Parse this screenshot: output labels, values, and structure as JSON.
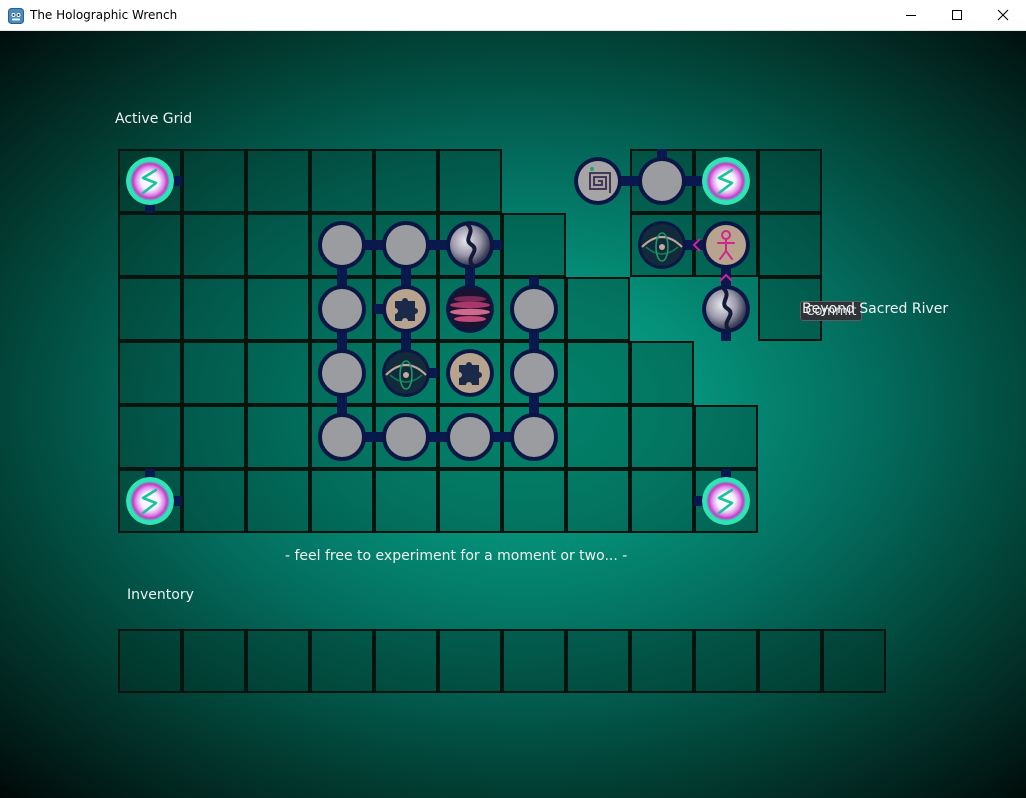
{
  "window": {
    "title": "The Holographic Wrench",
    "controls": [
      "minimize-icon",
      "maximize-icon",
      "close-icon"
    ]
  },
  "labels": {
    "active_grid": "Active Grid",
    "commit_button": "Commit",
    "result_text": "Beyond Sacred River",
    "hint": "- feel free to experiment for a moment or two... -",
    "inventory": "Inventory"
  },
  "grid": {
    "rows": [
      "######..###",
      "#######.###",
      "########..#",
      "#########..",
      "##########.",
      "##########."
    ],
    "pieces": [
      {
        "row": 0,
        "col": 0,
        "type": "spark-icon"
      },
      {
        "row": 0,
        "col": 7,
        "type": "spiral-icon"
      },
      {
        "row": 0,
        "col": 8,
        "type": "node"
      },
      {
        "row": 0,
        "col": 9,
        "type": "spark-icon"
      },
      {
        "row": 1,
        "col": 3,
        "type": "node"
      },
      {
        "row": 1,
        "col": 4,
        "type": "node"
      },
      {
        "row": 1,
        "col": 5,
        "type": "river-icon"
      },
      {
        "row": 1,
        "col": 8,
        "type": "eye-icon"
      },
      {
        "row": 1,
        "col": 9,
        "type": "figure-icon"
      },
      {
        "row": 2,
        "col": 3,
        "type": "node"
      },
      {
        "row": 2,
        "col": 4,
        "type": "puzzle-icon"
      },
      {
        "row": 2,
        "col": 5,
        "type": "disc-icon"
      },
      {
        "row": 2,
        "col": 6,
        "type": "node"
      },
      {
        "row": 2,
        "col": 9,
        "type": "river-icon"
      },
      {
        "row": 3,
        "col": 3,
        "type": "node"
      },
      {
        "row": 3,
        "col": 4,
        "type": "eye-icon"
      },
      {
        "row": 3,
        "col": 5,
        "type": "puzzle-icon"
      },
      {
        "row": 3,
        "col": 6,
        "type": "node"
      },
      {
        "row": 4,
        "col": 3,
        "type": "node"
      },
      {
        "row": 4,
        "col": 4,
        "type": "node"
      },
      {
        "row": 4,
        "col": 5,
        "type": "node"
      },
      {
        "row": 4,
        "col": 6,
        "type": "node"
      },
      {
        "row": 5,
        "col": 0,
        "type": "spark-icon"
      },
      {
        "row": 5,
        "col": 9,
        "type": "spark-icon"
      }
    ],
    "links": [
      {
        "row": 1,
        "col": 3,
        "dir": "right"
      },
      {
        "row": 1,
        "col": 4,
        "dir": "right"
      },
      {
        "row": 1,
        "col": 3,
        "dir": "down"
      },
      {
        "row": 2,
        "col": 3,
        "dir": "down"
      },
      {
        "row": 3,
        "col": 3,
        "dir": "down"
      },
      {
        "row": 1,
        "col": 4,
        "dir": "down"
      },
      {
        "row": 2,
        "col": 4,
        "dir": "down"
      },
      {
        "row": 1,
        "col": 5,
        "dir": "down"
      },
      {
        "row": 2,
        "col": 6,
        "dir": "down"
      },
      {
        "row": 3,
        "col": 6,
        "dir": "down"
      },
      {
        "row": 4,
        "col": 3,
        "dir": "right"
      },
      {
        "row": 4,
        "col": 4,
        "dir": "right"
      },
      {
        "row": 4,
        "col": 5,
        "dir": "right"
      },
      {
        "row": 0,
        "col": 7,
        "dir": "right"
      },
      {
        "row": 0,
        "col": 8,
        "dir": "right"
      },
      {
        "row": 1,
        "col": 8,
        "dir": "right"
      },
      {
        "row": 1,
        "col": 9,
        "dir": "down"
      }
    ],
    "stubs": [
      {
        "row": 0,
        "col": 0,
        "side": "right"
      },
      {
        "row": 0,
        "col": 0,
        "side": "bottom"
      },
      {
        "row": 5,
        "col": 0,
        "side": "top"
      },
      {
        "row": 5,
        "col": 0,
        "side": "right"
      },
      {
        "row": 5,
        "col": 9,
        "side": "top"
      },
      {
        "row": 5,
        "col": 9,
        "side": "left"
      },
      {
        "row": 0,
        "col": 8,
        "side": "top"
      },
      {
        "row": 2,
        "col": 6,
        "side": "top"
      },
      {
        "row": 2,
        "col": 9,
        "side": "bottom"
      },
      {
        "row": 3,
        "col": 4,
        "side": "right"
      },
      {
        "row": 1,
        "col": 5,
        "side": "right"
      },
      {
        "row": 2,
        "col": 4,
        "side": "left"
      }
    ]
  },
  "inventory": {
    "slot_count": 12,
    "items": []
  },
  "colors": {
    "background_center": "#04a88a",
    "connector": "#0a1850",
    "spark_ring": "#2ee6b4",
    "node_fill": "#9a9c9f",
    "accent_magenta": "#d0268c"
  }
}
